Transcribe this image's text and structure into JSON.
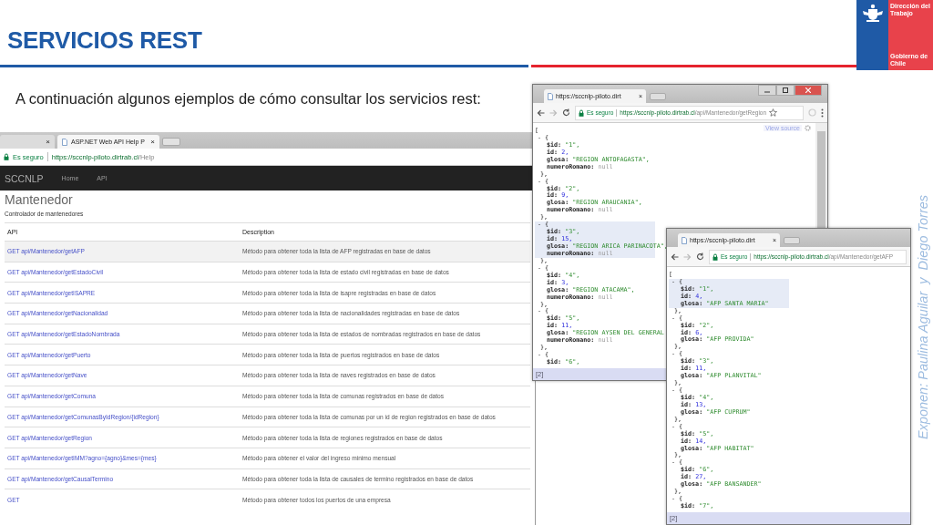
{
  "slide": {
    "title": "SERVICIOS REST",
    "intro": "A continuación algunos ejemplos de cómo consultar los servicios rest:",
    "logo": {
      "name": "Dirección del Trabajo",
      "government": "Gobierno de Chile"
    },
    "speakers": "Exponen: Paulina Aguilar  y  Diego Torres"
  },
  "help_window": {
    "tabs": [
      {
        "close": "×",
        "selected": false
      },
      {
        "label": "ASP.NET Web API Help P",
        "close": "×",
        "selected": true
      }
    ],
    "address": {
      "security": "Es seguro",
      "host": "https://sccnlp-piloto.dirtrab.cl",
      "path": "/Help"
    },
    "navbar": {
      "brand": "SCCNLP",
      "links": [
        "Home",
        "API"
      ]
    },
    "heading": "Mantenedor",
    "description": "Controlador de mantenedores",
    "table": {
      "columns": [
        "API",
        "Description"
      ],
      "rows": [
        {
          "api": "GET api/Mantenedor/getAFP",
          "description": "Método para obtener toda la lista de AFP registradas en base de datos",
          "highlighted": true
        },
        {
          "api": "GET api/Mantenedor/getEstadoCivil",
          "description": "Método para obtener toda la lista de estado civil registradas en base de datos",
          "highlighted": false
        },
        {
          "api": "GET api/Mantenedor/getISAPRE",
          "description": "Método para obtener toda la lista de isapre registradas en base de datos",
          "highlighted": false
        },
        {
          "api": "GET api/Mantenedor/getNacionalidad",
          "description": "Método para obtener toda la lista de nacionalidades registradas en base de datos",
          "highlighted": false
        },
        {
          "api": "GET api/Mantenedor/getEstadoNombrada",
          "description": "Método para obtener toda la lista de estados de nombradas registrados en base de datos",
          "highlighted": false
        },
        {
          "api": "GET api/Mantenedor/getPuerto",
          "description": "Método para obtener toda la lista de puertos registrados en base de datos",
          "highlighted": false
        },
        {
          "api": "GET api/Mantenedor/getNave",
          "description": "Método para obtener toda la lista de naves registrados en base de datos",
          "highlighted": false
        },
        {
          "api": "GET api/Mantenedor/getComuna",
          "description": "Método para obtener toda la lista de comunas registrados en base de datos",
          "highlighted": false
        },
        {
          "api": "GET api/Mantenedor/getComunasByIdRegion/{idRegion}",
          "description": "Método para obtener toda la lista de comunas por un id de region registrados en base de datos",
          "highlighted": false
        },
        {
          "api": "GET api/Mantenedor/getRegion",
          "description": "Método para obtener toda la lista de regiones registrados en base de datos",
          "highlighted": false
        },
        {
          "api": "GET api/Mantenedor/getIMM?agno={agno}&mes={mes}",
          "description": "Método para obtener el valor del ingreso minimo mensual",
          "highlighted": false
        },
        {
          "api": "GET api/Mantenedor/getCausalTermino",
          "description": "Método para obtener toda la lista de causales de termino registrados en base de datos",
          "highlighted": false
        },
        {
          "api": "GET",
          "description": "Método para obtener todos los puertos de una empresa",
          "highlighted": false
        }
      ]
    }
  },
  "json_windows": [
    {
      "tab": {
        "label": "https://sccnlp-piloto.dirt",
        "close": "×",
        "selected": true
      },
      "window_controls": true,
      "toolbar_icons": true,
      "scrollbar": true,
      "address": {
        "security": "Es seguro",
        "host": "https://sccnlp-piloto.dirtrab.cl",
        "path": "/api/Mantenedor/getRegion"
      },
      "view_source": "View source",
      "document": {
        "open": "[",
        "objects": [
          {
            "highlighted": false,
            "open": "- {",
            "fields": [
              {
                "key": "$id:",
                "value": "\"1\",",
                "kind": "string"
              },
              {
                "key": "id:",
                "value": "2,",
                "kind": "number"
              },
              {
                "key": "glosa:",
                "value": "\"REGION ANTOFAGASTA\",",
                "kind": "string"
              },
              {
                "key": "numeroRomano:",
                "value": "null",
                "kind": "null"
              }
            ],
            "close": "},"
          },
          {
            "highlighted": false,
            "open": "- {",
            "fields": [
              {
                "key": "$id:",
                "value": "\"2\",",
                "kind": "string"
              },
              {
                "key": "id:",
                "value": "9,",
                "kind": "number"
              },
              {
                "key": "glosa:",
                "value": "\"REGION ARAUCANIA\",",
                "kind": "string"
              },
              {
                "key": "numeroRomano:",
                "value": "null",
                "kind": "null"
              }
            ],
            "close": "},"
          },
          {
            "highlighted": true,
            "open": "- {",
            "fields": [
              {
                "key": "$id:",
                "value": "\"3\",",
                "kind": "string"
              },
              {
                "key": "id:",
                "value": "15,",
                "kind": "number"
              },
              {
                "key": "glosa:",
                "value": "\"REGION ARICA PARINACOTA\",",
                "kind": "string"
              },
              {
                "key": "numeroRomano:",
                "value": "null",
                "kind": "null"
              }
            ],
            "close": "},"
          },
          {
            "highlighted": false,
            "open": "- {",
            "fields": [
              {
                "key": "$id:",
                "value": "\"4\",",
                "kind": "string"
              },
              {
                "key": "id:",
                "value": "3,",
                "kind": "number"
              },
              {
                "key": "glosa:",
                "value": "\"REGION ATACAMA\",",
                "kind": "string"
              },
              {
                "key": "numeroRomano:",
                "value": "null",
                "kind": "null"
              }
            ],
            "close": "},"
          },
          {
            "highlighted": false,
            "open": "- {",
            "fields": [
              {
                "key": "$id:",
                "value": "\"5\",",
                "kind": "string"
              },
              {
                "key": "id:",
                "value": "11,",
                "kind": "number"
              },
              {
                "key": "glosa:",
                "value": "\"REGION AYSEN DEL GENERAL",
                "kind": "string"
              },
              {
                "key": "numeroRomano:",
                "value": "null",
                "kind": "null"
              }
            ],
            "close": "},"
          },
          {
            "highlighted": false,
            "open": "- {",
            "fields": [
              {
                "key": "$id:",
                "value": "\"6\",",
                "kind": "string"
              }
            ]
          }
        ]
      },
      "status": "[2]"
    },
    {
      "tab": {
        "label": "https://sccnlp-piloto.dirt",
        "close": "×",
        "selected": true
      },
      "address": {
        "security": "Es seguro",
        "host": "https://sccnlp-piloto.dirtrab.cl",
        "path": "/api/Mantenedor/getAFP"
      },
      "document": {
        "open": "[",
        "objects": [
          {
            "highlighted": true,
            "open": "- {",
            "fields": [
              {
                "key": "$id:",
                "value": "\"1\",",
                "kind": "string"
              },
              {
                "key": "id:",
                "value": "4,",
                "kind": "number"
              },
              {
                "key": "glosa:",
                "value": "\"AFP SANTA MARIA\"",
                "kind": "string"
              }
            ],
            "close": "},"
          },
          {
            "highlighted": false,
            "open": "- {",
            "fields": [
              {
                "key": "$id:",
                "value": "\"2\",",
                "kind": "string"
              },
              {
                "key": "id:",
                "value": "6,",
                "kind": "number"
              },
              {
                "key": "glosa:",
                "value": "\"AFP PROVIDA\"",
                "kind": "string"
              }
            ],
            "close": "},"
          },
          {
            "highlighted": false,
            "open": "- {",
            "fields": [
              {
                "key": "$id:",
                "value": "\"3\",",
                "kind": "string"
              },
              {
                "key": "id:",
                "value": "11,",
                "kind": "number"
              },
              {
                "key": "glosa:",
                "value": "\"AFP PLANVITAL\"",
                "kind": "string"
              }
            ],
            "close": "},"
          },
          {
            "highlighted": false,
            "open": "- {",
            "fields": [
              {
                "key": "$id:",
                "value": "\"4\",",
                "kind": "string"
              },
              {
                "key": "id:",
                "value": "13,",
                "kind": "number"
              },
              {
                "key": "glosa:",
                "value": "\"AFP CUPRUM\"",
                "kind": "string"
              }
            ],
            "close": "},"
          },
          {
            "highlighted": false,
            "open": "- {",
            "fields": [
              {
                "key": "$id:",
                "value": "\"5\",",
                "kind": "string"
              },
              {
                "key": "id:",
                "value": "14,",
                "kind": "number"
              },
              {
                "key": "glosa:",
                "value": "\"AFP HABITAT\"",
                "kind": "string"
              }
            ],
            "close": "},"
          },
          {
            "highlighted": false,
            "open": "- {",
            "fields": [
              {
                "key": "$id:",
                "value": "\"6\",",
                "kind": "string"
              },
              {
                "key": "id:",
                "value": "27,",
                "kind": "number"
              },
              {
                "key": "glosa:",
                "value": "\"AFP BANSANDER\"",
                "kind": "string"
              }
            ],
            "close": "},"
          },
          {
            "highlighted": false,
            "open": "- {",
            "fields": [
              {
                "key": "$id:",
                "value": "\"7\",",
                "kind": "string"
              }
            ]
          }
        ]
      },
      "status": "[2]"
    }
  ]
}
